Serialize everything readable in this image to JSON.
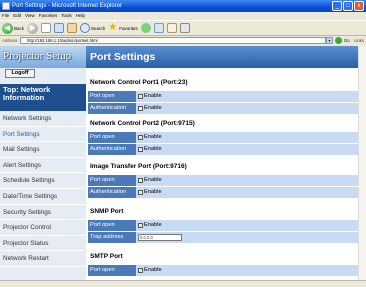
{
  "window": {
    "title": "Port Settings - Microsoft Internet Explorer",
    "controls": [
      "_",
      "□",
      "x"
    ]
  },
  "menu": [
    "File",
    "Edit",
    "View",
    "Favorites",
    "Tools",
    "Help"
  ],
  "toolbar": {
    "back": "Back",
    "search": "Search",
    "favorites": "Favorites"
  },
  "address": {
    "label": "Address",
    "url": "http://192.168.1.10/admin/portset.html",
    "go": "Go",
    "links": "Links"
  },
  "sidebar": {
    "logo": "Projector Setup",
    "logoff": "Logoff",
    "top_heading": "Top: Network Information",
    "items": [
      {
        "label": "Network Settings",
        "active": false
      },
      {
        "label": "Port Settings",
        "active": true
      },
      {
        "label": "Mail Settings",
        "active": false
      },
      {
        "label": "Alert Settings",
        "active": false
      },
      {
        "label": "Schedule Settings",
        "active": false
      },
      {
        "label": "Date/Time Settings",
        "active": false
      },
      {
        "label": "Security Settings",
        "active": false
      },
      {
        "label": "Projector Control",
        "active": false
      },
      {
        "label": "Projector Status",
        "active": false
      },
      {
        "label": "Network Restart",
        "active": false
      }
    ]
  },
  "main": {
    "title": "Port Settings",
    "sections": [
      {
        "title": "Network Control Port1 (Port:23)",
        "rows": [
          {
            "label": "Port open",
            "type": "checkbox",
            "checked": true,
            "text": "Enable"
          },
          {
            "label": "Authentication",
            "type": "checkbox",
            "checked": false,
            "text": "Enable"
          }
        ]
      },
      {
        "title": "Network Control Port2 (Port:9715)",
        "rows": [
          {
            "label": "Port open",
            "type": "checkbox",
            "checked": true,
            "text": "Enable"
          },
          {
            "label": "Authentication",
            "type": "checkbox",
            "checked": true,
            "text": "Enable"
          }
        ]
      },
      {
        "title": "Image Transfer Port (Port:9716)",
        "rows": [
          {
            "label": "Port open",
            "type": "checkbox",
            "checked": true,
            "text": "Enable"
          },
          {
            "label": "Authentication",
            "type": "checkbox",
            "checked": true,
            "text": "Enable"
          }
        ]
      },
      {
        "title": "SNMP Port",
        "rows": [
          {
            "label": "Port open",
            "type": "checkbox",
            "checked": true,
            "text": "Enable"
          },
          {
            "label": "Trap address",
            "type": "text",
            "value": "0.0.0.0"
          }
        ]
      },
      {
        "title": "SMTP Port",
        "rows": [
          {
            "label": "Port open",
            "type": "checkbox",
            "checked": true,
            "text": "Enable"
          }
        ]
      }
    ]
  },
  "colors": {
    "accent": "#2a5fa8",
    "row_label": "#4a7ab8",
    "row_value": "#c8dbf2",
    "sidebar": "#e6ecf3"
  }
}
